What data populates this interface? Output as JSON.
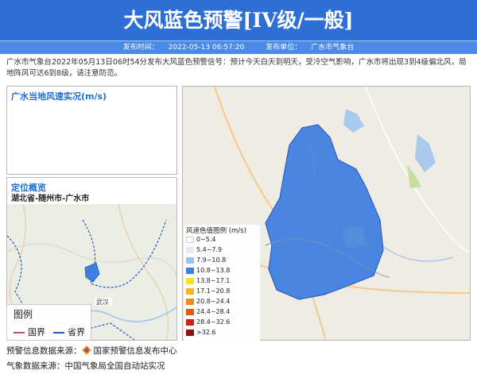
{
  "header": {
    "title": "大风蓝色预警[IV级/一般]",
    "publish_time_label": "发布时间：",
    "publish_time": "2022-05-13 06:57:20",
    "publish_unit_label": "发布单位：",
    "publish_unit": "广水市气象台"
  },
  "description": "广水市气象台2022年05月13日06时54分发布大风蓝色预警信号：预计今天白天到明天，受冷空气影响，广水市将出现3到4级偏北风，局地阵风可达6到8级，请注意防范。",
  "wind_panel": {
    "title": "广水当地风速实况(m/s)"
  },
  "location_panel": {
    "title": "定位概览",
    "subtitle": "湖北省-随州市-广水市",
    "map_labels": {
      "wuhan": "武汉"
    },
    "legend": {
      "title": "图例",
      "items": [
        {
          "label": "国界",
          "color": "#c84a78"
        },
        {
          "label": "省界",
          "color": "#2e58c7"
        }
      ]
    }
  },
  "map_panel": {
    "region_color": "#3f7fe0",
    "scale": {
      "title": "风速色值图例 (m/s)",
      "rows": [
        {
          "label": "0~5.4",
          "color": "#ffffff"
        },
        {
          "label": "5.4~7.9",
          "color": "#e0ecfa"
        },
        {
          "label": "7.9~10.8",
          "color": "#9ec3f2"
        },
        {
          "label": "10.8~13.8",
          "color": "#3f7fe0"
        },
        {
          "label": "13.8~17.1",
          "color": "#f7e21c"
        },
        {
          "label": "17.1~20.8",
          "color": "#f5b323"
        },
        {
          "label": "20.8~24.4",
          "color": "#f08a1e"
        },
        {
          "label": "24.4~28.4",
          "color": "#e35a18"
        },
        {
          "label": "28.4~32.6",
          "color": "#c8231a"
        },
        {
          "label": ">32.6",
          "color": "#8e1212"
        }
      ]
    }
  },
  "footer": {
    "warning_source_label": "预警信息数据来源：",
    "warning_source": "国家预警信息发布中心",
    "weather_source_label": "气象数据来源：",
    "weather_source": "中国气象局全国自动站实况"
  }
}
